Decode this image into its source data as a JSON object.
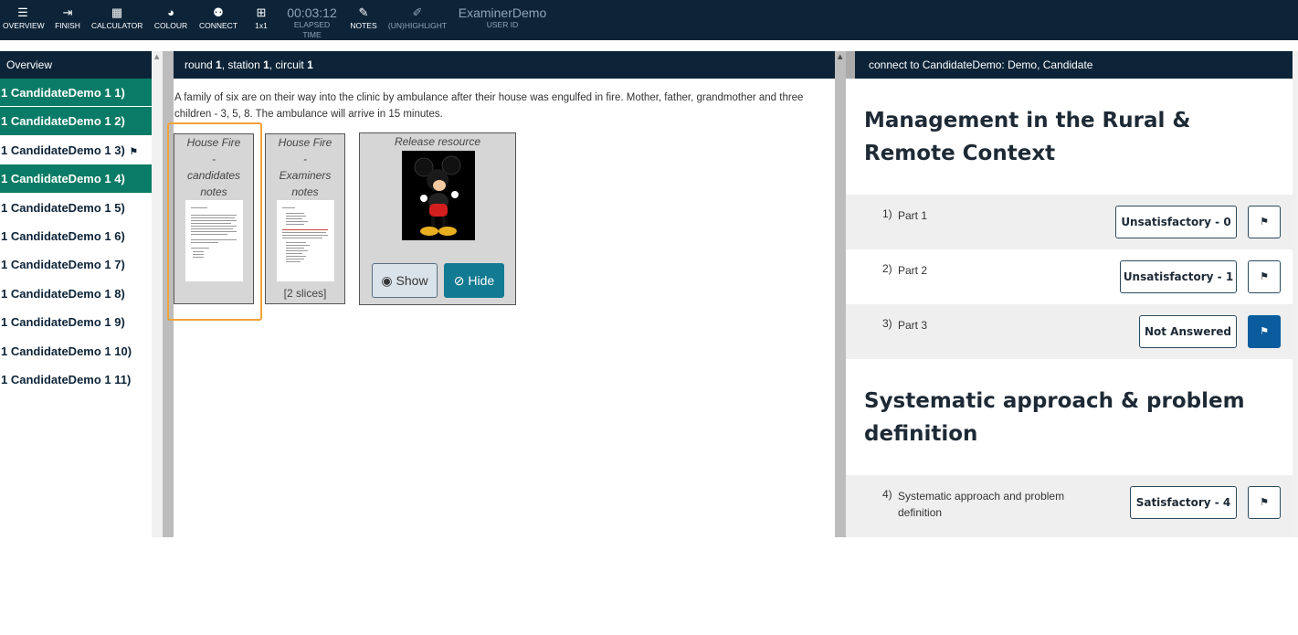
{
  "toolbar": {
    "items": [
      {
        "label": "OVERVIEW",
        "icon": "overview-icon"
      },
      {
        "label": "FINISH",
        "icon": "finish-icon"
      },
      {
        "label": "CALCULATOR",
        "icon": "calculator-icon"
      },
      {
        "label": "COLOUR",
        "icon": "palette-icon"
      },
      {
        "label": "CONNECT",
        "icon": "connect-icon"
      },
      {
        "label": "1x1",
        "icon": "grid-icon"
      }
    ],
    "elapsed_time": "00:03:12",
    "elapsed_label": "ELAPSED TIME",
    "notes_label": "NOTES",
    "highlight_label": "(UN)HIGHLIGHT",
    "user_name": "ExaminerDemo",
    "user_id_label": "USER ID"
  },
  "sidebar": {
    "title": "Overview",
    "items": [
      {
        "label": "1 CandidateDemo 1  1)",
        "active": true
      },
      {
        "label": "1 CandidateDemo 1  2)",
        "active": true
      },
      {
        "label": "1 CandidateDemo 1  3)",
        "active": false,
        "flagged": true
      },
      {
        "label": "1 CandidateDemo 1  4)",
        "active": true
      },
      {
        "label": "1 CandidateDemo 1  5)",
        "active": false
      },
      {
        "label": "1 CandidateDemo 1  6)",
        "active": false
      },
      {
        "label": "1 CandidateDemo 1  7)",
        "active": false
      },
      {
        "label": "1 CandidateDemo 1  8)",
        "active": false
      },
      {
        "label": "1 CandidateDemo 1  9)",
        "active": false
      },
      {
        "label": "1 CandidateDemo 1  10)",
        "active": false
      },
      {
        "label": "1 CandidateDemo 1  11)",
        "active": false
      }
    ]
  },
  "station": {
    "round_word": "round ",
    "round": "1",
    "station_word": ", station ",
    "station": "1",
    "circuit_word": ", circuit ",
    "circuit": "1",
    "scenario": "A family of six are on their way into the clinic by ambulance after their house was engulfed in fire. Mother, father, grandmother and three children - 3, 5, 8. The ambulance will arrive in 15 minutes.",
    "resources": [
      {
        "title_lines": [
          "House Fire",
          "-",
          "candidates",
          "notes"
        ]
      },
      {
        "title_lines": [
          "House Fire",
          "-",
          "Examiners",
          "notes"
        ],
        "slices": "[2 slices]"
      },
      {
        "title": "Release resource",
        "show_label": "Show",
        "hide_label": "Hide"
      }
    ]
  },
  "assessment": {
    "header": "connect to CandidateDemo: Demo, Candidate",
    "sections": [
      {
        "title": "Management in the Rural & Remote Context"
      },
      {
        "title": "Systematic approach & problem definition"
      }
    ],
    "questions": [
      {
        "num": "1)",
        "text": "Part 1",
        "grade": "Unsatisfactory - 0",
        "flagged": false
      },
      {
        "num": "2)",
        "text": "Part 2",
        "grade": "Unsatisfactory - 1",
        "flagged": false
      },
      {
        "num": "3)",
        "text": "Part 3",
        "grade": "Not Answered",
        "flagged": true
      },
      {
        "num": "4)",
        "text": "Systematic approach and problem definition",
        "grade": "Satisfactory - 4",
        "flagged": false
      }
    ]
  },
  "colors": {
    "navy": "#0d2438",
    "teal_active": "#0a7b66",
    "hide_button": "#137a93",
    "flag_on": "#0a5c9c",
    "highlight_outline": "#f0a23a"
  }
}
